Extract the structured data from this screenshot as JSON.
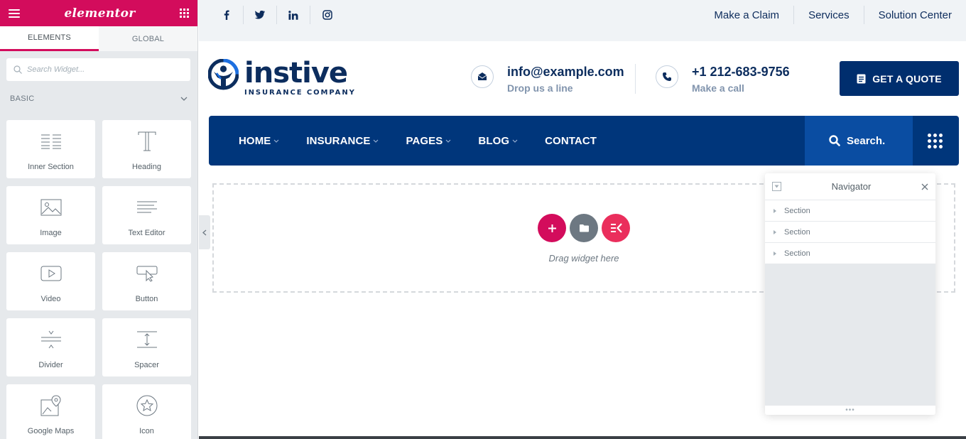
{
  "editor": {
    "brand": "elementor",
    "tabs": [
      {
        "label": "ELEMENTS"
      },
      {
        "label": "GLOBAL"
      }
    ],
    "search_placeholder": "Search Widget...",
    "category": "BASIC",
    "widgets": [
      {
        "label": "Inner Section",
        "icon": "inner-section-icon"
      },
      {
        "label": "Heading",
        "icon": "heading-icon"
      },
      {
        "label": "Image",
        "icon": "image-icon"
      },
      {
        "label": "Text Editor",
        "icon": "text-editor-icon"
      },
      {
        "label": "Video",
        "icon": "video-icon"
      },
      {
        "label": "Button",
        "icon": "button-icon"
      },
      {
        "label": "Divider",
        "icon": "divider-icon"
      },
      {
        "label": "Spacer",
        "icon": "spacer-icon"
      },
      {
        "label": "Google Maps",
        "icon": "google-maps-icon"
      },
      {
        "label": "Icon",
        "icon": "star-icon"
      }
    ]
  },
  "site": {
    "social": [
      "facebook-icon",
      "twitter-icon",
      "linkedin-icon",
      "instagram-icon"
    ],
    "top_links": [
      "Make a Claim",
      "Services",
      "Solution Center"
    ],
    "logo": {
      "name": "instive",
      "subtitle": "INSURANCE COMPANY"
    },
    "email": {
      "main": "info@example.com",
      "sub": "Drop us a line"
    },
    "phone": {
      "main": "+1 212-683-9756",
      "sub": "Make a call"
    },
    "quote_button": "GET A QUOTE",
    "nav": [
      "HOME",
      "INSURANCE",
      "PAGES",
      "BLOG",
      "CONTACT"
    ],
    "search_label": "Search.",
    "drop_text": "Drag widget here"
  },
  "navigator": {
    "title": "Navigator",
    "rows": [
      "Section",
      "Section",
      "Section"
    ]
  },
  "colors": {
    "elementor_pink": "#d30c5c",
    "navy": "#0c2d5e",
    "nav_blue": "#00367b",
    "search_blue": "#0a4da2"
  }
}
